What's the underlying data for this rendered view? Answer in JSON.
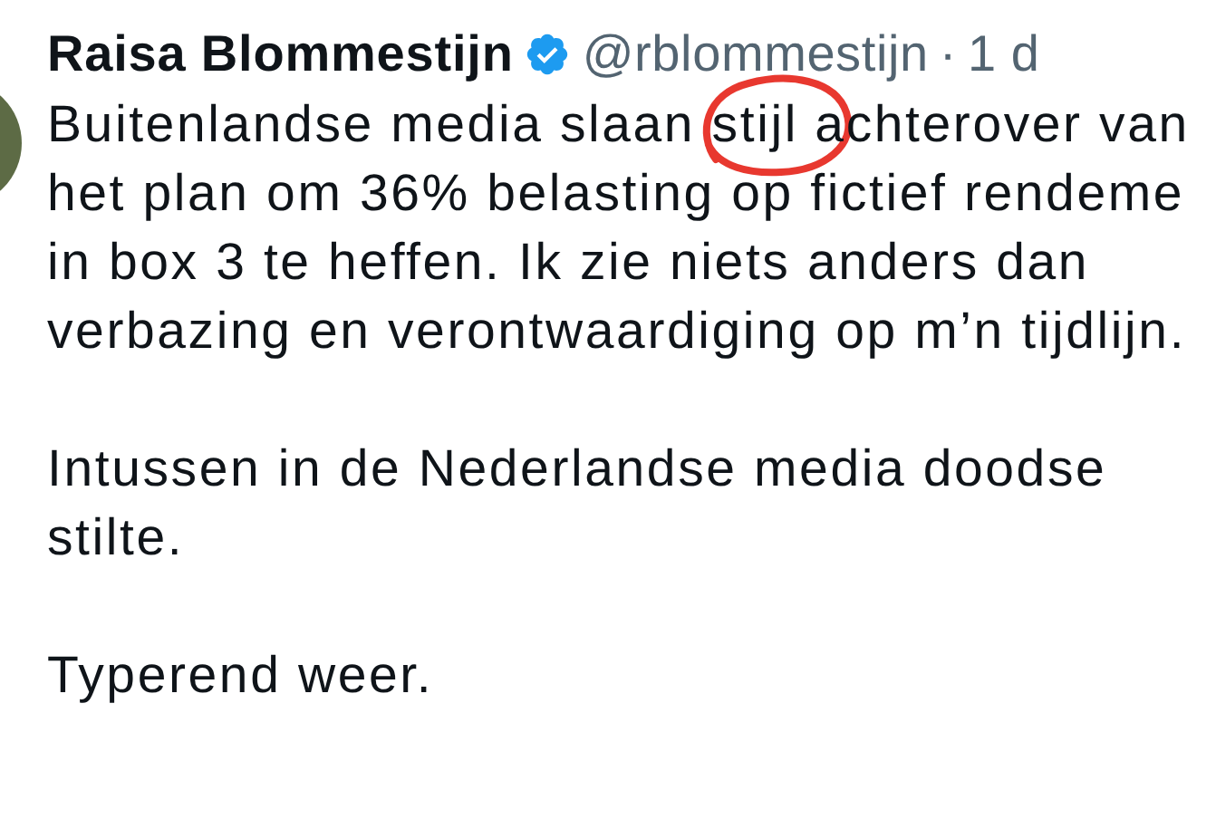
{
  "author": {
    "name": "Raisa Blommestijn",
    "verified": true,
    "handle": "@rblommestijn",
    "separator": "·",
    "time": "1 d"
  },
  "paragraphs": [
    {
      "lines": [
        "Buitenlandse media slaan stijl achterover van",
        "het plan om 36% belasting op fictief rendeme",
        "in box 3 te heffen. Ik zie niets anders dan",
        "verbazing en verontwaardiging op m’n tijdlijn."
      ]
    },
    {
      "lines": [
        "Intussen in de Nederlandse media doodse",
        "stilte."
      ]
    },
    {
      "lines": [
        "Typerend weer."
      ]
    }
  ],
  "annotation": {
    "kind": "circle",
    "color": "#e8382f"
  }
}
